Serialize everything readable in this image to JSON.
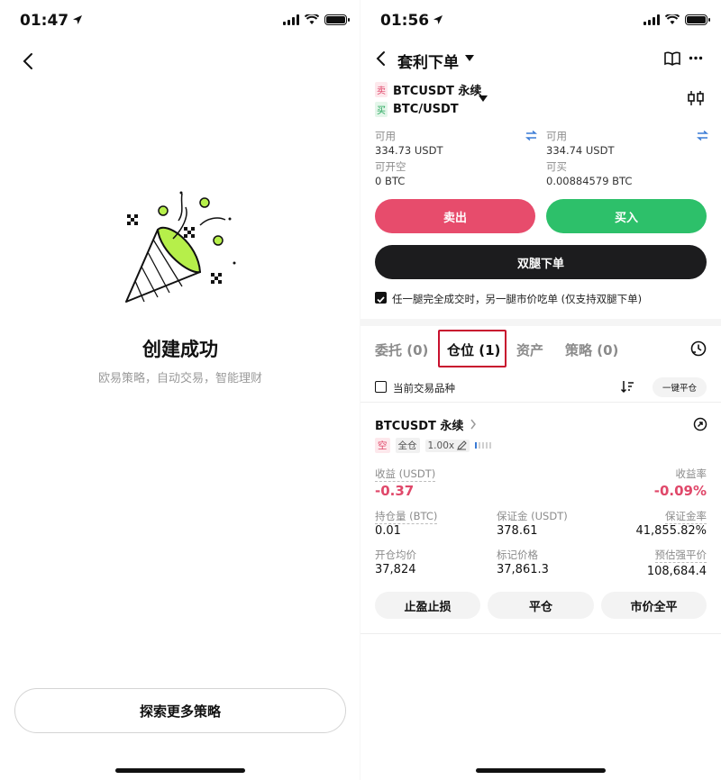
{
  "left": {
    "status_time": "01:47",
    "success_title": "创建成功",
    "success_subtitle": "欧易策略，自动交易，智能理财",
    "explore_button": "探索更多策略"
  },
  "right": {
    "status_time": "01:56",
    "header_title": "套利下单",
    "sell_tag": "卖",
    "buy_tag": "买",
    "pair_sell": "BTCUSDT 永续",
    "pair_buy": "BTC/USDT",
    "left_col": {
      "available_label": "可用",
      "available_value": "334.73 USDT",
      "open_label": "可开空",
      "open_value": "0 BTC"
    },
    "right_col": {
      "available_label": "可用",
      "available_value": "334.74 USDT",
      "open_label": "可买",
      "open_value": "0.00884579 BTC"
    },
    "sell_button": "卖出",
    "buy_button": "买入",
    "dual_button": "双腿下单",
    "checkbox_label": "任一腿完全成交时，另一腿市价吃单 (仅支持双腿下单)",
    "tabs": [
      "委托 (0)",
      "仓位 (1)",
      "资产",
      "策略 (0)"
    ],
    "current_pair_label": "当前交易品种",
    "close_all_button": "一键平仓",
    "position": {
      "pair": "BTCUSDT 永续",
      "side_tag": "空",
      "margin_tag": "全仓",
      "leverage": "1.00x",
      "pnl_label": "收益 (USDT)",
      "pnl_value": "-0.37",
      "pnl_rate_label": "收益率",
      "pnl_rate_value": "-0.09%",
      "size_label": "持仓量 (BTC)",
      "size_value": "0.01",
      "margin_label": "保证金 (USDT)",
      "margin_value": "378.61",
      "margin_ratio_label": "保证金率",
      "margin_ratio_value": "41,855.82%",
      "entry_label": "开仓均价",
      "entry_value": "37,824",
      "mark_label": "标记价格",
      "mark_value": "37,861.3",
      "liq_label": "预估强平价",
      "liq_value": "108,684.4"
    },
    "tp_sl_button": "止盈止损",
    "close_button": "平仓",
    "market_close_button": "市价全平"
  },
  "colors": {
    "sell": "#e74c6c",
    "buy": "#2dc06a",
    "highlight": "#c8102e",
    "link_blue": "#3a7bd5"
  }
}
